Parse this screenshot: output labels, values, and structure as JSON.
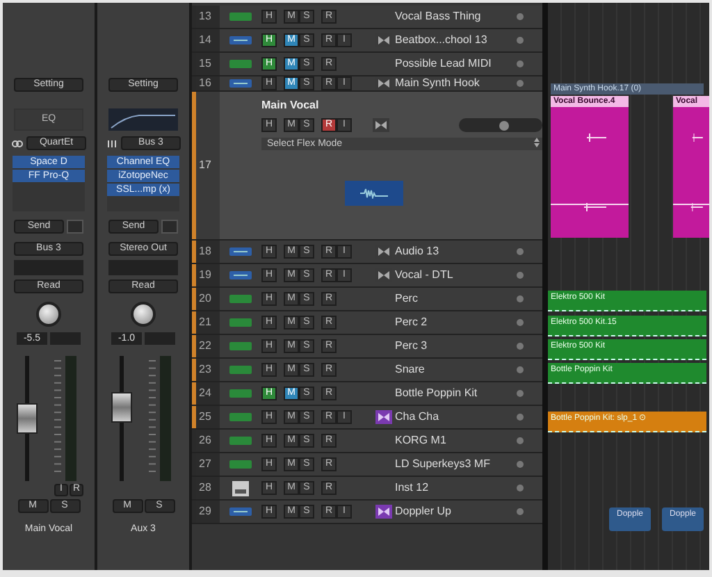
{
  "mixer": {
    "strips": [
      {
        "setting": "Setting",
        "eq": {
          "kind": "text",
          "label": "EQ"
        },
        "input": {
          "kind": "link",
          "label": "QuartEt"
        },
        "inserts": [
          "Space D",
          "FF Pro-Q"
        ],
        "send": "Send",
        "output": "Bus 3",
        "automation": "Read",
        "pan_value": "-5.5",
        "level": 0.5,
        "extra_buttons": [
          "I",
          "R"
        ],
        "mute": "M",
        "solo": "S",
        "name": "Main Vocal"
      },
      {
        "setting": "Setting",
        "eq": {
          "kind": "curve"
        },
        "input": {
          "kind": "stereo",
          "label": "Bus 3"
        },
        "inserts": [
          "Channel EQ",
          "iZotopeNec",
          "SSL...mp (x)"
        ],
        "send": "Send",
        "output": "Stereo Out",
        "automation": "Read",
        "pan_value": "-1.0",
        "level": 0.62,
        "mute": "M",
        "solo": "S",
        "name": "Aux 3"
      }
    ]
  },
  "tracks": [
    {
      "number": "13",
      "kind": "midi",
      "selected": false,
      "buttons": [
        {
          "label": "H",
          "on": false
        },
        {
          "label": "M",
          "on": false
        },
        {
          "label": "S",
          "on": false
        },
        {
          "label": "R",
          "on": false
        }
      ],
      "name": "Vocal Bass Thing"
    },
    {
      "number": "14",
      "kind": "audio",
      "selected": false,
      "input_monitor_on": false,
      "buttons": [
        {
          "label": "H",
          "on": true
        },
        {
          "label": "M",
          "on": true
        },
        {
          "label": "S",
          "on": false
        },
        {
          "label": "R",
          "on": false
        },
        {
          "label": "I",
          "on": false
        }
      ],
      "name": "Beatbox...chool 13"
    },
    {
      "number": "15",
      "kind": "midi",
      "selected": false,
      "buttons": [
        {
          "label": "H",
          "on": true
        },
        {
          "label": "M",
          "on": true
        },
        {
          "label": "S",
          "on": false
        },
        {
          "label": "R",
          "on": false
        }
      ],
      "name": "Possible Lead MIDI"
    },
    {
      "number": "16",
      "kind": "audio",
      "selected": false,
      "input_monitor_on": false,
      "buttons": [
        {
          "label": "H",
          "on": false
        },
        {
          "label": "M",
          "on": true
        },
        {
          "label": "S",
          "on": false
        },
        {
          "label": "R",
          "on": false
        },
        {
          "label": "I",
          "on": false
        }
      ],
      "name": "Main Synth Hook"
    },
    {
      "number": "17",
      "kind": "expanded",
      "selected": true,
      "input_monitor_on": false,
      "level": 0.55,
      "buttons": [
        {
          "label": "H",
          "on": false
        },
        {
          "label": "M",
          "on": false
        },
        {
          "label": "S",
          "on": false
        },
        {
          "label": "R",
          "on": true
        },
        {
          "label": "I",
          "on": false
        }
      ],
      "name": "Main Vocal",
      "flex_mode": "Select Flex Mode"
    },
    {
      "number": "18",
      "kind": "audio",
      "selected": true,
      "input_monitor_on": false,
      "buttons": [
        {
          "label": "H",
          "on": false
        },
        {
          "label": "M",
          "on": false
        },
        {
          "label": "S",
          "on": false
        },
        {
          "label": "R",
          "on": false
        },
        {
          "label": "I",
          "on": false
        }
      ],
      "name": "Audio 13"
    },
    {
      "number": "19",
      "kind": "audio",
      "selected": true,
      "input_monitor_on": false,
      "buttons": [
        {
          "label": "H",
          "on": false
        },
        {
          "label": "M",
          "on": false
        },
        {
          "label": "S",
          "on": false
        },
        {
          "label": "R",
          "on": false
        },
        {
          "label": "I",
          "on": false
        }
      ],
      "name": "Vocal - DTL"
    },
    {
      "number": "20",
      "kind": "midi",
      "selected": true,
      "buttons": [
        {
          "label": "H",
          "on": false
        },
        {
          "label": "M",
          "on": false
        },
        {
          "label": "S",
          "on": false
        },
        {
          "label": "R",
          "on": false
        }
      ],
      "name": "Perc"
    },
    {
      "number": "21",
      "kind": "midi",
      "selected": true,
      "buttons": [
        {
          "label": "H",
          "on": false
        },
        {
          "label": "M",
          "on": false
        },
        {
          "label": "S",
          "on": false
        },
        {
          "label": "R",
          "on": false
        }
      ],
      "name": "Perc 2"
    },
    {
      "number": "22",
      "kind": "midi",
      "selected": true,
      "buttons": [
        {
          "label": "H",
          "on": false
        },
        {
          "label": "M",
          "on": false
        },
        {
          "label": "S",
          "on": false
        },
        {
          "label": "R",
          "on": false
        }
      ],
      "name": "Perc 3"
    },
    {
      "number": "23",
      "kind": "midi",
      "selected": true,
      "buttons": [
        {
          "label": "H",
          "on": false
        },
        {
          "label": "M",
          "on": false
        },
        {
          "label": "S",
          "on": false
        },
        {
          "label": "R",
          "on": false
        }
      ],
      "name": "Snare"
    },
    {
      "number": "24",
      "kind": "midi",
      "selected": true,
      "buttons": [
        {
          "label": "H",
          "on": true
        },
        {
          "label": "M",
          "on": true
        },
        {
          "label": "S",
          "on": false
        },
        {
          "label": "R",
          "on": false
        }
      ],
      "name": "Bottle Poppin Kit"
    },
    {
      "number": "25",
      "kind": "midi",
      "selected": true,
      "input_monitor_on": true,
      "buttons": [
        {
          "label": "H",
          "on": false
        },
        {
          "label": "M",
          "on": false
        },
        {
          "label": "S",
          "on": false
        },
        {
          "label": "R",
          "on": false
        },
        {
          "label": "I",
          "on": false
        }
      ],
      "name": "Cha Cha"
    },
    {
      "number": "26",
      "kind": "midi",
      "selected": false,
      "buttons": [
        {
          "label": "H",
          "on": false
        },
        {
          "label": "M",
          "on": false
        },
        {
          "label": "S",
          "on": false
        },
        {
          "label": "R",
          "on": false
        }
      ],
      "name": "KORG M1"
    },
    {
      "number": "27",
      "kind": "midi",
      "selected": false,
      "buttons": [
        {
          "label": "H",
          "on": false
        },
        {
          "label": "M",
          "on": false
        },
        {
          "label": "S",
          "on": false
        },
        {
          "label": "R",
          "on": false
        }
      ],
      "name": "LD Superkeys3 MF"
    },
    {
      "number": "28",
      "kind": "instrument",
      "selected": false,
      "buttons": [
        {
          "label": "H",
          "on": false
        },
        {
          "label": "M",
          "on": false
        },
        {
          "label": "S",
          "on": false
        },
        {
          "label": "R",
          "on": false
        }
      ],
      "name": "Inst 12"
    },
    {
      "number": "29",
      "kind": "audio",
      "selected": false,
      "input_monitor_on": true,
      "buttons": [
        {
          "label": "H",
          "on": false
        },
        {
          "label": "M",
          "on": false
        },
        {
          "label": "S",
          "on": false
        },
        {
          "label": "R",
          "on": false
        },
        {
          "label": "I",
          "on": false
        }
      ],
      "name": "Doppler Up"
    }
  ],
  "arrange": {
    "regions": [
      {
        "kind": "header",
        "name": "Main Synth Hook.17 (0)",
        "color": "#4a5a70"
      },
      {
        "kind": "audio",
        "name": "Vocal Bounce.4",
        "color": "#c21a9c"
      },
      {
        "kind": "audio",
        "name": "Vocal",
        "color": "#c21a9c"
      },
      {
        "kind": "midi",
        "name": "Elektro 500 Kit",
        "color": "#1f8a2e"
      },
      {
        "kind": "midi",
        "name": "Elektro 500 Kit.15",
        "color": "#1f8a2e"
      },
      {
        "kind": "midi",
        "name": "Elektro 500 Kit",
        "color": "#1f8a2e"
      },
      {
        "kind": "midi",
        "name": "Bottle Poppin Kit",
        "color": "#1f8a2e"
      },
      {
        "kind": "midi",
        "name": "Bottle Poppin Kit: slp_1 ⊙",
        "color": "#d57f10"
      },
      {
        "kind": "button",
        "name": "Dopple",
        "color": "#2f5a8c"
      },
      {
        "kind": "button",
        "name": "Dopple",
        "color": "#2f5a8c"
      }
    ]
  }
}
